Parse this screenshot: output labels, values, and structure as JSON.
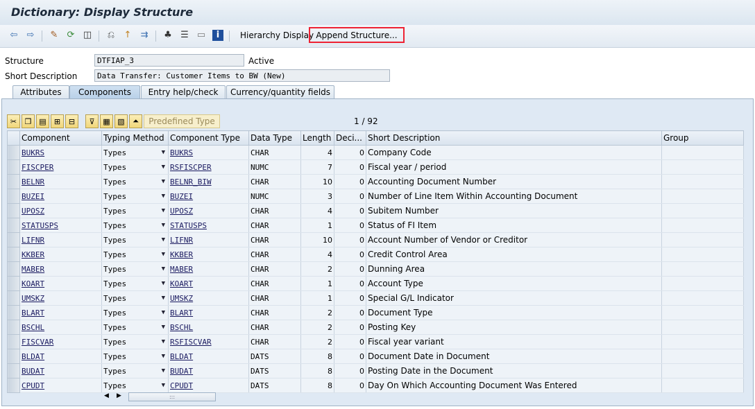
{
  "title": "Dictionary: Display Structure",
  "toolbar": {
    "icons": [
      "back-icon",
      "forward-icon",
      "edit-icon",
      "other-object-icon",
      "check-icon",
      "activate-icon",
      "where-used-icon",
      "display-object-list-icon",
      "hierarchy-icon",
      "print-icon",
      "info-icon"
    ],
    "hierarchy_display": "Hierarchy Display",
    "append_structure": "Append Structure..."
  },
  "header": {
    "structure_label": "Structure",
    "structure_value": "DTFIAP_3",
    "structure_status": "Active",
    "short_desc_label": "Short Description",
    "short_desc_value": "Data Transfer: Customer Items to BW (New)"
  },
  "tabs": [
    {
      "label": "Attributes"
    },
    {
      "label": "Components"
    },
    {
      "label": "Entry help/check"
    },
    {
      "label": "Currency/quantity fields"
    }
  ],
  "table_toolbar": {
    "predefined_type": "Predefined Type",
    "counter": "1 / 92"
  },
  "columns": [
    "Component",
    "Typing Method",
    "Component Type",
    "Data Type",
    "Length",
    "Deci...",
    "Short Description",
    "Group"
  ],
  "rows": [
    {
      "component": "BUKRS",
      "typing": "Types",
      "ctype": "BUKRS",
      "dtype": "CHAR",
      "length": "4",
      "dec": "0",
      "desc": "Company Code"
    },
    {
      "component": "FISCPER",
      "typing": "Types",
      "ctype": "RSFISCPER",
      "dtype": "NUMC",
      "length": "7",
      "dec": "0",
      "desc": "Fiscal year / period"
    },
    {
      "component": "BELNR",
      "typing": "Types",
      "ctype": "BELNR_BIW",
      "dtype": "CHAR",
      "length": "10",
      "dec": "0",
      "desc": "Accounting Document Number"
    },
    {
      "component": "BUZEI",
      "typing": "Types",
      "ctype": "BUZEI",
      "dtype": "NUMC",
      "length": "3",
      "dec": "0",
      "desc": "Number of Line Item Within Accounting Document"
    },
    {
      "component": "UPOSZ",
      "typing": "Types",
      "ctype": "UPOSZ",
      "dtype": "CHAR",
      "length": "4",
      "dec": "0",
      "desc": "Subitem Number"
    },
    {
      "component": "STATUSPS",
      "typing": "Types",
      "ctype": "STATUSPS",
      "dtype": "CHAR",
      "length": "1",
      "dec": "0",
      "desc": "Status of FI Item"
    },
    {
      "component": "LIFNR",
      "typing": "Types",
      "ctype": "LIFNR",
      "dtype": "CHAR",
      "length": "10",
      "dec": "0",
      "desc": "Account Number of Vendor or Creditor"
    },
    {
      "component": "KKBER",
      "typing": "Types",
      "ctype": "KKBER",
      "dtype": "CHAR",
      "length": "4",
      "dec": "0",
      "desc": "Credit Control Area"
    },
    {
      "component": "MABER",
      "typing": "Types",
      "ctype": "MABER",
      "dtype": "CHAR",
      "length": "2",
      "dec": "0",
      "desc": "Dunning Area"
    },
    {
      "component": "KOART",
      "typing": "Types",
      "ctype": "KOART",
      "dtype": "CHAR",
      "length": "1",
      "dec": "0",
      "desc": "Account Type"
    },
    {
      "component": "UMSKZ",
      "typing": "Types",
      "ctype": "UMSKZ",
      "dtype": "CHAR",
      "length": "1",
      "dec": "0",
      "desc": "Special G/L Indicator"
    },
    {
      "component": "BLART",
      "typing": "Types",
      "ctype": "BLART",
      "dtype": "CHAR",
      "length": "2",
      "dec": "0",
      "desc": "Document Type"
    },
    {
      "component": "BSCHL",
      "typing": "Types",
      "ctype": "BSCHL",
      "dtype": "CHAR",
      "length": "2",
      "dec": "0",
      "desc": "Posting Key"
    },
    {
      "component": "FISCVAR",
      "typing": "Types",
      "ctype": "RSFISCVAR",
      "dtype": "CHAR",
      "length": "2",
      "dec": "0",
      "desc": "Fiscal year variant"
    },
    {
      "component": "BLDAT",
      "typing": "Types",
      "ctype": "BLDAT",
      "dtype": "DATS",
      "length": "8",
      "dec": "0",
      "desc": "Document Date in Document"
    },
    {
      "component": "BUDAT",
      "typing": "Types",
      "ctype": "BUDAT",
      "dtype": "DATS",
      "length": "8",
      "dec": "0",
      "desc": "Posting Date in the Document"
    },
    {
      "component": "CPUDT",
      "typing": "Types",
      "ctype": "CPUDT",
      "dtype": "DATS",
      "length": "8",
      "dec": "0",
      "desc": "Day On Which Accounting Document Was Entered"
    }
  ],
  "colors": {
    "highlight": "#e22233",
    "panel": "#dfe9f4"
  }
}
